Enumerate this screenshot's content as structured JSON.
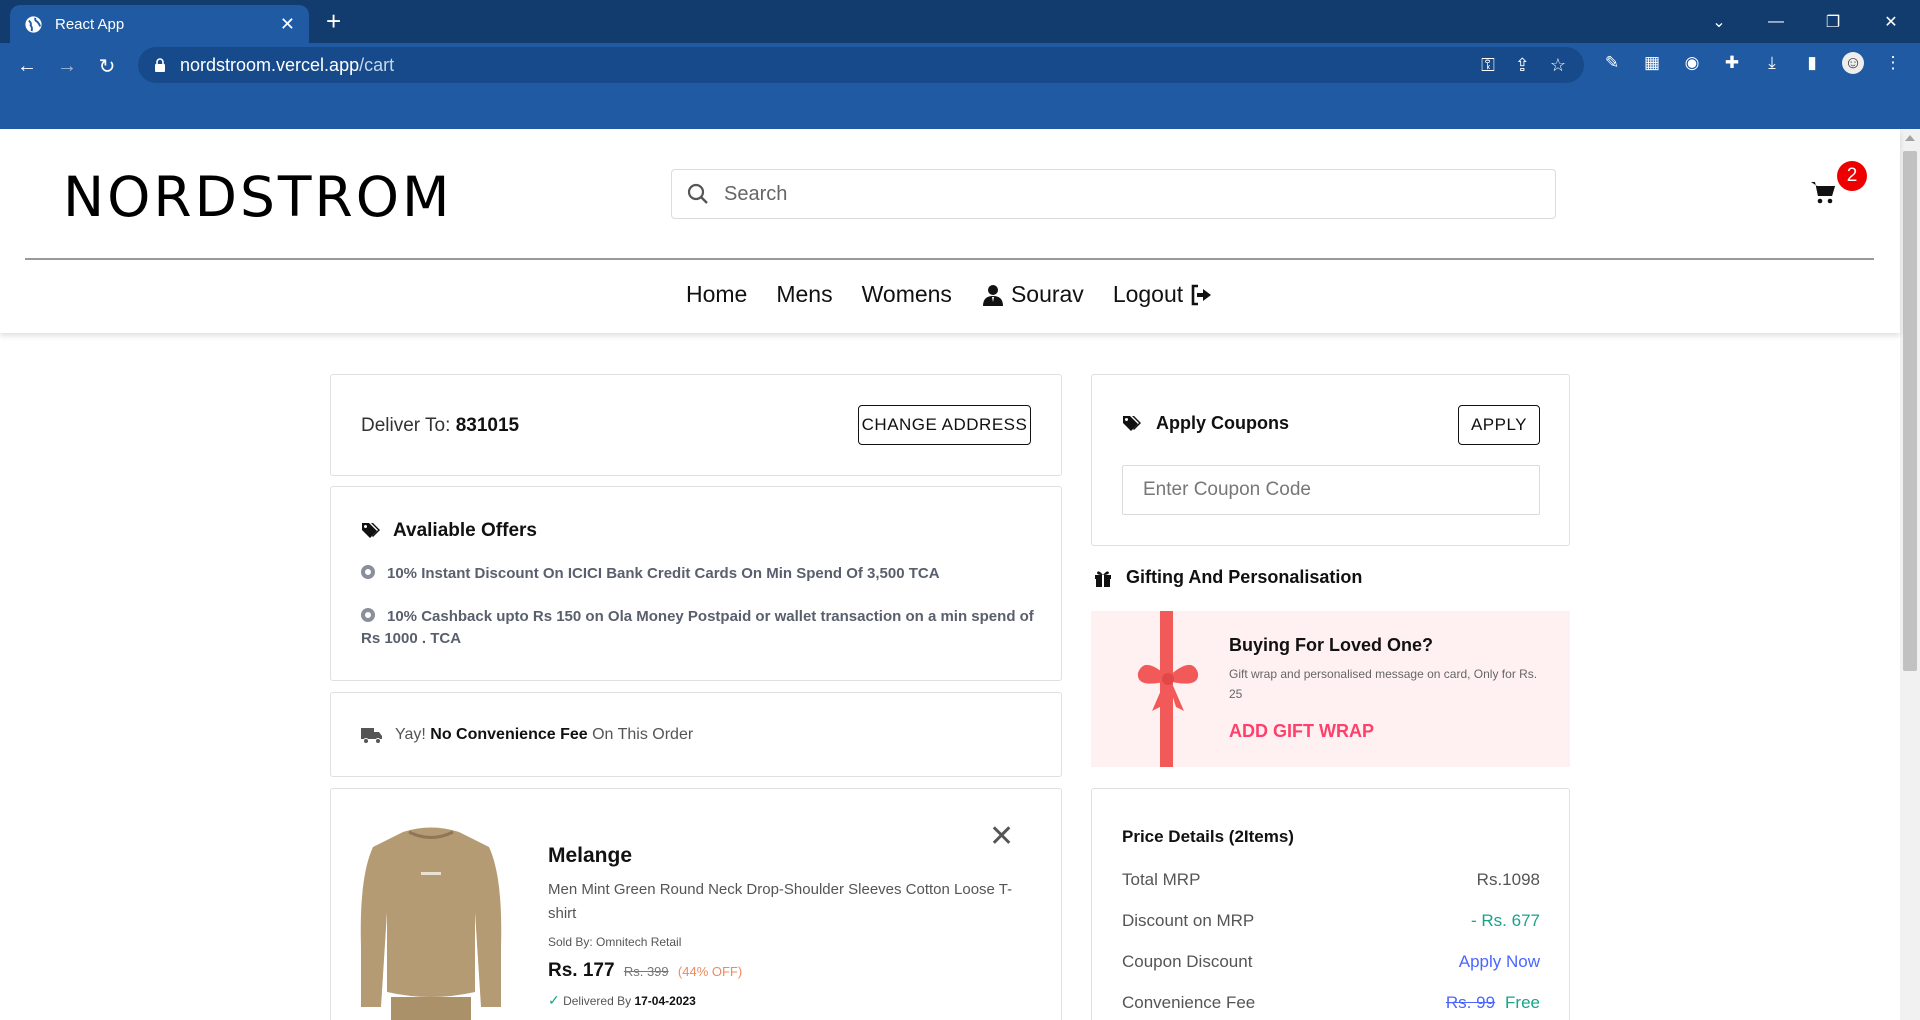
{
  "browser": {
    "tab_title": "React App",
    "url_host": "nordstroom.vercel.app",
    "url_path": "/cart"
  },
  "header": {
    "logo": "NORDSTROM",
    "search_placeholder": "Search",
    "cart_count": "2",
    "nav": {
      "home": "Home",
      "mens": "Mens",
      "womens": "Womens",
      "user": "Sourav",
      "logout": "Logout"
    }
  },
  "deliver": {
    "label": "Deliver To: ",
    "pincode": "831015",
    "button": "CHANGE ADDRESS"
  },
  "offers": {
    "title": "Avaliable Offers",
    "items": [
      "10% Instant Discount On ICICI Bank Credit Cards On Min Spend Of 3,500 TCA",
      "10% Cashback upto Rs 150 on Ola Money Postpaid or wallet transaction on a min spend of Rs 1000 . TCA"
    ]
  },
  "convenience": {
    "prefix": "Yay! ",
    "bold": "No Convenience Fee",
    "suffix": " On This Order"
  },
  "cart_item": {
    "title": "Melange",
    "description": "Men Mint Green Round Neck Drop-Shoulder Sleeves Cotton Loose T-shirt",
    "sold_by": "Sold By: Omnitech Retail",
    "price": "Rs. 177",
    "mrp": "Rs. 399",
    "discount": "(44% OFF)",
    "delivered_label": "Delivered By ",
    "delivered_date": "17-04-2023"
  },
  "coupons": {
    "title": "Apply Coupons",
    "button": "APPLY",
    "placeholder": "Enter Coupon Code"
  },
  "gift": {
    "section_title": "Gifting And Personalisation",
    "title": "Buying For Loved One?",
    "description": "Gift wrap and personalised message on card, Only for Rs. 25",
    "link": "ADD GIFT WRAP"
  },
  "price_details": {
    "title": "Price Details (2Items)",
    "rows": [
      {
        "label": "Total MRP",
        "value": "Rs.1098"
      },
      {
        "label": "Discount on MRP",
        "value": "- Rs. 677"
      },
      {
        "label": "Coupon Discount",
        "value": "Apply Now"
      },
      {
        "label": "Convenience Fee",
        "strike": "Rs. 99",
        "value": "Free"
      }
    ]
  },
  "colors": {
    "browser_dark": "#123c6d",
    "browser_blue": "#1f5aa3",
    "badge_red": "#ee0000",
    "accent_pink": "#ff3f6c",
    "gift_bg": "#fff1f1",
    "ribbon": "#f25a5a",
    "green": "#1aa38a",
    "link_blue": "#4a66ff"
  }
}
